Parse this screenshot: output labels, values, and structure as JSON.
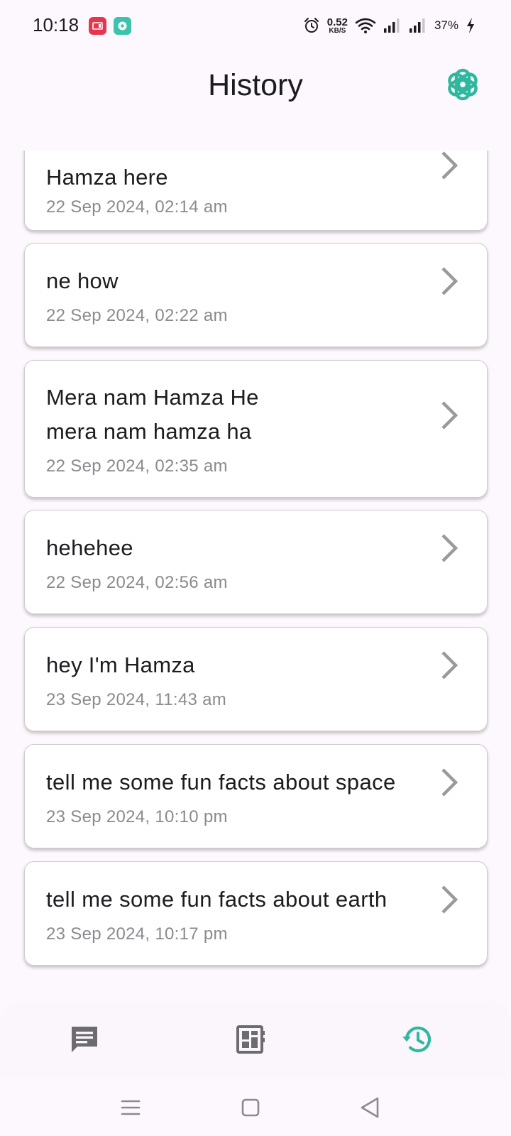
{
  "status_bar": {
    "time": "10:18",
    "net_speed_value": "0.52",
    "net_speed_unit": "KB/S",
    "battery": "37%"
  },
  "header": {
    "title": "History",
    "logo_icon": "openai-logo-icon"
  },
  "colors": {
    "accent": "#2fb89d",
    "icon_gray": "#6b6b70",
    "chevron_gray": "#9a9a9a",
    "date_gray": "#8a8a8f"
  },
  "history": {
    "items": [
      {
        "title": "Hamza here",
        "date": "22 Sep 2024, 02:14 am"
      },
      {
        "title": "ne how",
        "date": "22 Sep 2024, 02:22 am"
      },
      {
        "title_line1": "Mera nam Hamza He",
        "title_line2": "mera nam hamza ha",
        "date": "22 Sep 2024, 02:35 am"
      },
      {
        "title": "hehehee",
        "date": "22 Sep 2024, 02:56 am"
      },
      {
        "title": "hey I'm Hamza",
        "date": "23 Sep 2024, 11:43 am"
      },
      {
        "title": "tell me some fun facts about space",
        "date": "23 Sep 2024, 10:10 pm"
      },
      {
        "title": "tell me some fun facts about earth",
        "date": "23 Sep 2024, 10:17 pm"
      }
    ]
  },
  "bottom_nav": {
    "tabs": [
      {
        "icon": "chat-icon",
        "active": false
      },
      {
        "icon": "dashboard-icon",
        "active": false
      },
      {
        "icon": "history-icon",
        "active": true
      }
    ]
  }
}
